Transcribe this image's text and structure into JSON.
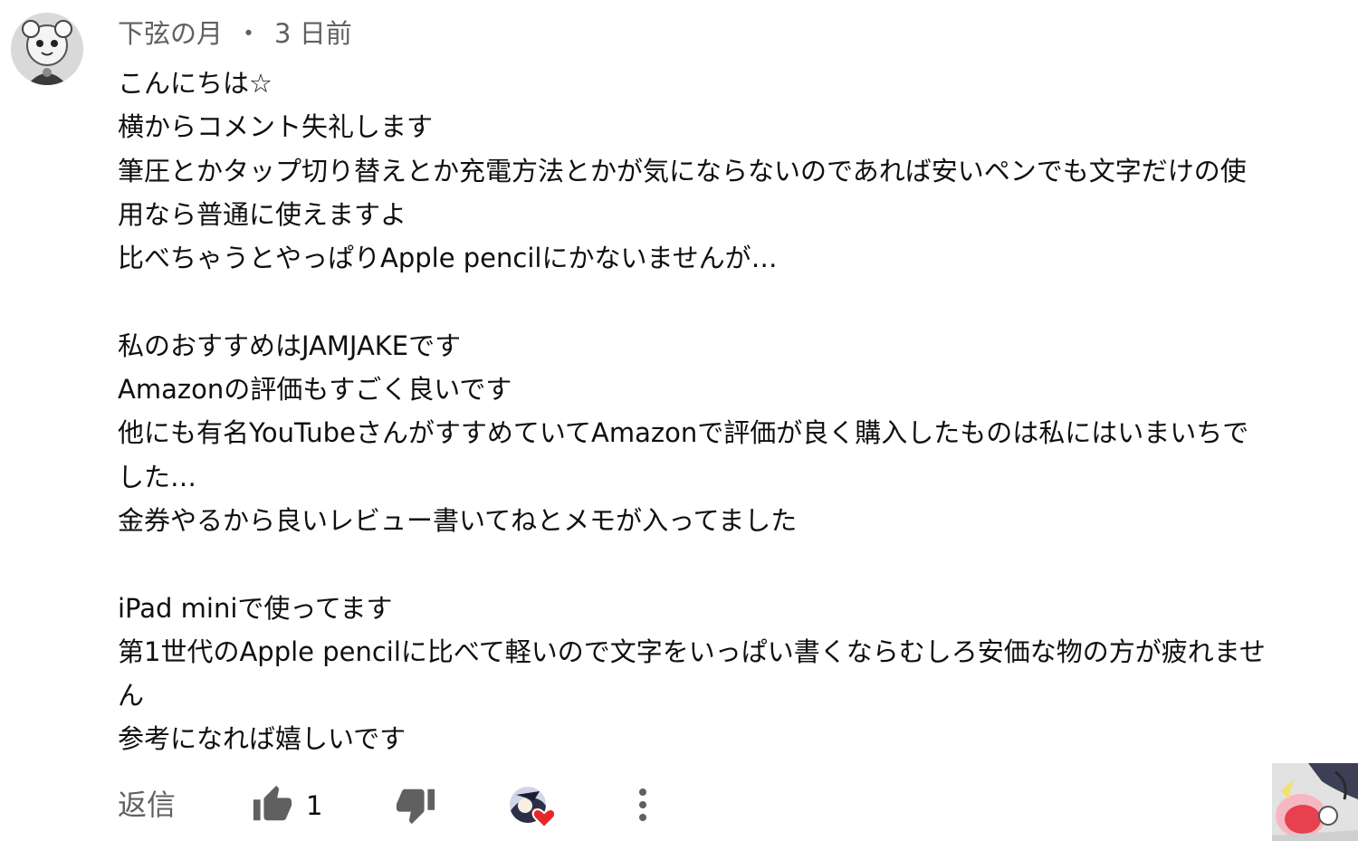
{
  "comment": {
    "author": "下弦の月",
    "separator": "・",
    "time": "3 日前",
    "lines": [
      "こんにちは☆",
      "横からコメント失礼します",
      "筆圧とかタップ切り替えとか充電方法とかが気にならないのであれば安いペンでも文字だけの使",
      "用なら普通に使えますよ",
      "比べちゃうとやっぱりApple pencilにかないませんが…",
      "",
      "私のおすすめはJAMJAKEです",
      "Amazonの評価もすごく良いです",
      "他にも有名YouTubeさんがすすめていてAmazonで評価が良く購入したものは私にはいまいちで",
      "した…",
      "金券やるから良いレビュー書いてねとメモが入ってました",
      "",
      "iPad miniで使ってます",
      "第1世代のApple pencilに比べて軽いので文字をいっぱい書くならむしろ安価な物の方が疲れませ",
      "ん",
      "参考になれば嬉しいです"
    ]
  },
  "actions": {
    "reply_label": "返信",
    "like_count": "1",
    "icons": {
      "like": "thumbs-up-icon",
      "dislike": "thumbs-down-icon",
      "creator_heart": "creator-heart-icon",
      "more": "more-vertical-icon"
    }
  },
  "colors": {
    "text_primary": "#0f0f0f",
    "text_secondary": "#606060",
    "icon": "#606060",
    "heart": "#e5272d",
    "background": "#ffffff"
  }
}
